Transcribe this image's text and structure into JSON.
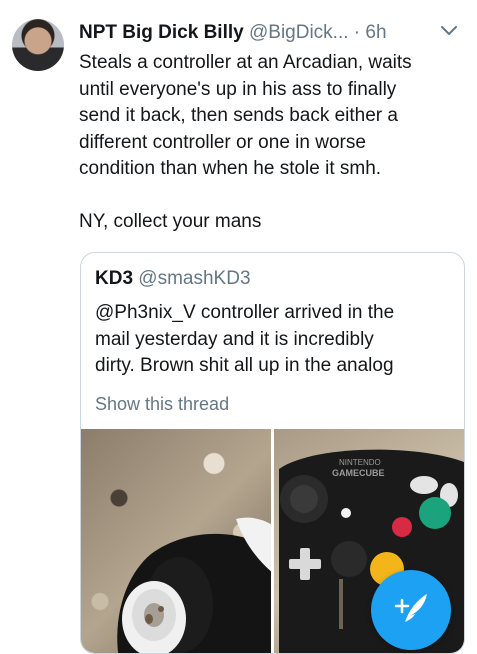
{
  "tweet": {
    "author_name": "NPT Big Dick Billy",
    "author_handle": "@BigDick...",
    "separator": "·",
    "timestamp": "6h",
    "text_line_1": "Steals a controller at an Arcadian, waits",
    "text_line_2": "until everyone's up in his ass to finally",
    "text_line_3": "send it back, then sends back either a",
    "text_line_4": "different controller or one in worse",
    "text_line_5": "condition than when he stole it smh.",
    "text_line_6": "NY, collect your mans"
  },
  "quoted_tweet": {
    "author_name": "KD3",
    "author_handle": "@smashKD3",
    "text_line_1": "@Ph3nix_V controller arrived in the",
    "text_line_2": "mail yesterday and it is incredibly",
    "text_line_3": "dirty. Brown shit all up in the analog",
    "show_thread_label": "Show this thread",
    "media_right_brand_top": "NINTENDO",
    "media_right_brand_bottom": "GAMECUBE"
  },
  "icons": {
    "caret": "chevron-down-icon",
    "compose": "compose-tweet-icon"
  },
  "colors": {
    "accent": "#1da1f2",
    "muted": "#657786",
    "text": "#14171a",
    "border": "#ccd6dd"
  }
}
